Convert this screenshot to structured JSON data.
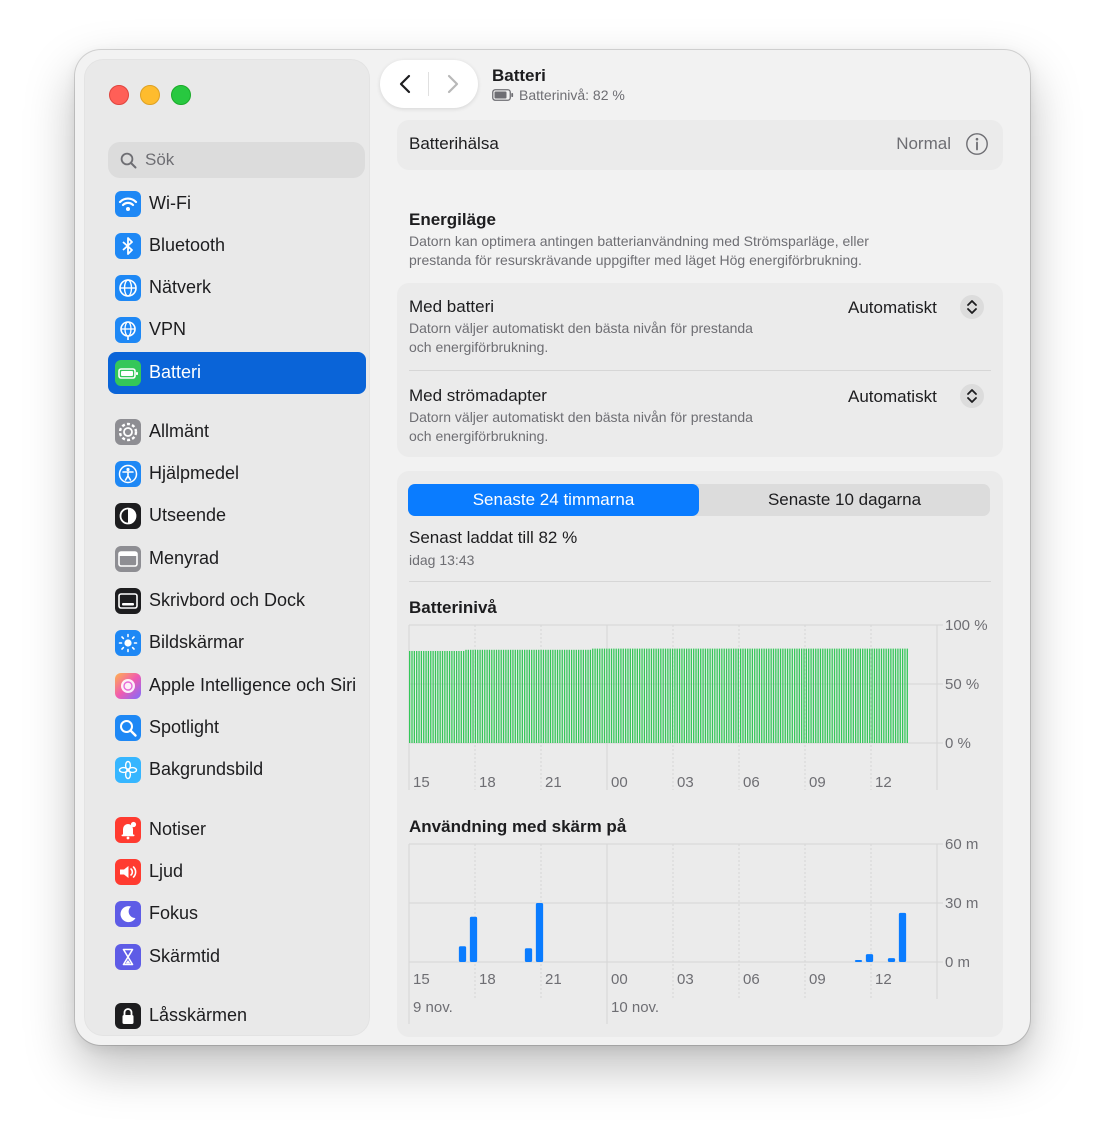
{
  "window": {
    "title": "Batteri",
    "subtitle": "Batterinivå: 82 %"
  },
  "sidebar": {
    "search_placeholder": "Sök",
    "items": [
      {
        "label": "Wi-Fi",
        "icon": "wifi-icon",
        "color": "#1e88f5"
      },
      {
        "label": "Bluetooth",
        "icon": "bluetooth-icon",
        "color": "#1e88f5"
      },
      {
        "label": "Nätverk",
        "icon": "globe-icon",
        "color": "#1e88f5"
      },
      {
        "label": "VPN",
        "icon": "vpn-globe-icon",
        "color": "#1e88f5"
      },
      {
        "label": "Batteri",
        "icon": "battery-icon",
        "color": "#34c759",
        "active": true
      },
      {
        "label": "Allmänt",
        "icon": "gear-icon",
        "color": "#8e8e93"
      },
      {
        "label": "Hjälpmedel",
        "icon": "accessibility-icon",
        "color": "#1e88f5"
      },
      {
        "label": "Utseende",
        "icon": "appearance-icon",
        "color": "#1d1d1f"
      },
      {
        "label": "Menyrad",
        "icon": "menubar-icon",
        "color": "#8e8e93"
      },
      {
        "label": "Skrivbord och Dock",
        "icon": "dock-icon",
        "color": "#1d1d1f"
      },
      {
        "label": "Bildskärmar",
        "icon": "sun-icon",
        "color": "#1e88f5"
      },
      {
        "label": "Apple Intelligence och Siri",
        "icon": "siri-icon",
        "color": "#e86bd8"
      },
      {
        "label": "Spotlight",
        "icon": "magnifier-icon",
        "color": "#1e88f5"
      },
      {
        "label": "Bakgrundsbild",
        "icon": "flower-icon",
        "color": "#36b6ff"
      },
      {
        "label": "Notiser",
        "icon": "bell-icon",
        "color": "#ff3b30"
      },
      {
        "label": "Ljud",
        "icon": "speaker-icon",
        "color": "#ff3b30"
      },
      {
        "label": "Fokus",
        "icon": "moon-icon",
        "color": "#5e5ce6"
      },
      {
        "label": "Skärmtid",
        "icon": "hourglass-icon",
        "color": "#5e5ce6"
      },
      {
        "label": "Låsskärmen",
        "icon": "lock-icon",
        "color": "#1d1d1f"
      }
    ]
  },
  "health": {
    "label": "Batterihälsa",
    "value": "Normal"
  },
  "energy": {
    "heading": "Energiläge",
    "description_line1": "Datorn kan optimera antingen batterianvändning med Strömsparläge, eller",
    "description_line2": "prestanda för resurskrävande uppgifter med läget Hög energiförbrukning.",
    "battery_mode": {
      "label": "Med batteri",
      "desc1": "Datorn väljer automatiskt den bästa nivån för prestanda",
      "desc2": "och energiförbrukning.",
      "value": "Automatiskt"
    },
    "adapter_mode": {
      "label": "Med strömadapter",
      "desc1": "Datorn väljer automatiskt den bästa nivån för prestanda",
      "desc2": "och energiförbrukning.",
      "value": "Automatiskt"
    }
  },
  "usage": {
    "tab_selected": "Senaste 24 timmarna",
    "tab_other": "Senaste 10 dagarna",
    "last_charged": "Senast laddat till 82 %",
    "last_charged_time": "idag 13:43"
  },
  "chart_data": [
    {
      "type": "bar",
      "title": "Batterinivå",
      "y_ticks": [
        "100 %",
        "50 %",
        "0 %"
      ],
      "ylim": [
        0,
        100
      ],
      "x_ticks": [
        "15",
        "18",
        "21",
        "00",
        "03",
        "06",
        "09",
        "12"
      ],
      "color": "#34c759",
      "values": [
        78,
        78,
        78,
        78,
        78,
        78,
        78,
        78,
        78,
        78,
        78,
        78,
        78,
        78,
        78,
        78,
        78,
        78,
        78,
        78,
        78,
        78,
        78,
        78,
        79,
        79,
        79,
        79,
        79,
        79,
        79,
        79,
        79,
        79,
        79,
        79,
        79,
        79,
        79,
        79,
        79,
        79,
        79,
        79,
        79,
        79,
        79,
        79,
        79,
        79,
        79,
        79,
        79,
        79,
        79,
        79,
        79,
        79,
        79,
        79,
        79,
        79,
        79,
        79,
        79,
        79,
        79,
        79,
        79,
        79,
        79,
        79,
        79,
        79,
        79,
        79,
        79,
        79,
        80,
        80,
        80,
        80,
        80,
        80,
        80,
        80,
        80,
        80,
        80,
        80,
        80,
        80,
        80,
        80,
        80,
        80,
        80,
        80,
        80,
        80,
        80,
        80,
        80,
        80,
        80,
        80,
        80,
        80,
        80,
        80,
        80,
        80,
        80,
        80,
        80,
        80,
        80,
        80,
        80,
        80,
        80,
        80,
        80,
        80,
        80,
        80,
        80,
        80,
        80,
        80,
        80,
        80,
        80,
        80,
        80,
        80,
        80,
        80,
        80,
        80,
        80,
        80,
        80,
        80,
        80,
        80,
        80,
        80,
        80,
        80,
        80,
        80,
        80,
        80,
        80,
        80,
        80,
        80,
        80,
        80,
        80,
        80,
        80,
        80,
        80,
        80,
        80,
        80,
        80,
        80,
        80,
        80,
        80,
        80,
        80,
        80,
        80,
        80,
        80,
        80,
        80,
        80,
        80,
        80,
        80,
        80,
        80,
        80,
        80,
        80,
        80,
        80,
        80,
        80,
        80,
        80,
        80,
        80,
        80,
        80,
        80,
        80,
        80,
        80,
        80,
        80,
        80,
        80,
        80,
        80,
        80,
        80,
        80
      ]
    },
    {
      "type": "bar",
      "title": "Användning med skärm på",
      "y_ticks": [
        "60 m",
        "30 m",
        "0 m"
      ],
      "ylim": [
        0,
        60
      ],
      "x_ticks": [
        "15",
        "18",
        "21",
        "00",
        "03",
        "06",
        "09",
        "12"
      ],
      "x_dates": [
        "9 nov.",
        "10 nov."
      ],
      "color": "#0a7cff",
      "unit": "minutes",
      "values": [
        0,
        0,
        0,
        0,
        8,
        23,
        0,
        0,
        0,
        0,
        7,
        30,
        0,
        0,
        0,
        0,
        0,
        0,
        0,
        0,
        0,
        0,
        0,
        0,
        0,
        0,
        0,
        0,
        0,
        0,
        0,
        0,
        0,
        0,
        0,
        0,
        0,
        0,
        0,
        0,
        1,
        4,
        0,
        2,
        25
      ]
    }
  ]
}
